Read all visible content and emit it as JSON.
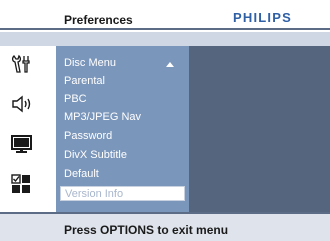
{
  "header": {
    "title": "Preferences",
    "brand": "PHILIPS"
  },
  "icons": [
    "settings-tools-icon",
    "speaker-icon",
    "monitor-icon",
    "preferences-grid-icon"
  ],
  "menu": {
    "items": [
      "Disc Menu",
      "Parental",
      "PBC",
      "MP3/JPEG Nav",
      "Password",
      "DivX Subtitle",
      "Default"
    ],
    "selected": "Version Info"
  },
  "footer": {
    "hint": "Press OPTIONS to exit menu"
  },
  "colors": {
    "menu_panel": "#7b96bb",
    "right_panel": "#55657d",
    "brand": "#2f5fa5"
  }
}
